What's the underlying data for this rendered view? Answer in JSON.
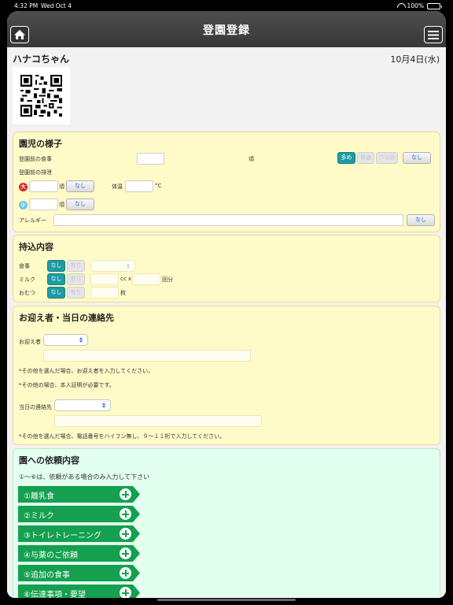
{
  "status_bar": {
    "time": "4:32 PM",
    "date": "Wed Oct 4",
    "battery": "100%"
  },
  "navbar": {
    "title": "登園登録"
  },
  "header": {
    "child_name": "ハナコちゃん",
    "date": "10月4日(水)"
  },
  "icons": {
    "home": "home-icon",
    "menu": "hamburger-menu-icon",
    "qr": "qr-code-icon",
    "expand": "plus-circle-icon"
  },
  "colors": {
    "teal_selected": "#1e9ba4",
    "section_yellow": "#fffbc8",
    "section_green": "#e3fff0",
    "item_green": "#14a04e",
    "poop_red": "#d9222a",
    "pee_blue": "#6ec3ef"
  },
  "condition": {
    "title": "園児の様子",
    "meal_label": "登園前の食事",
    "time_suffix": "頃",
    "amount_options": [
      "多め",
      "普通",
      "少な目"
    ],
    "selected_amount": "多め",
    "none_label": "なし",
    "excretion_label": "登園前の排泄",
    "poop_badge": "大",
    "pee_badge": "小",
    "temp_label": "体温",
    "temp_unit": "°C",
    "allergy_label": "アレルギー"
  },
  "belongings": {
    "title": "持込内容",
    "food_label": "食事",
    "milk_label": "ミルク",
    "diaper_label": "おむつ",
    "none_label": "なし",
    "present_label": "有り",
    "cc_label": "cc x",
    "times_label": "回分",
    "sheets_label": "枚"
  },
  "pickup": {
    "title": "お迎え者・当日の連絡先",
    "pickup_label": "お迎え者",
    "note1": "*その他を選んだ場合、お迎え者を入力してください。",
    "note2": "*その他の場合、本人証明が必要です。",
    "contact_label": "当日の連絡先",
    "note3": "*その他を選んだ場合、電話番号をハイフン無し、９～１１桁で入力してください。"
  },
  "requests": {
    "title": "園への依頼内容",
    "instruction": "①～⑥は、依頼がある場合のみ入力して下さい",
    "items": [
      "①離乳食",
      "②ミルク",
      "③トイレトレーニング",
      "④与薬のご依頼",
      "⑤追加の食事",
      "⑥伝達事項・要望"
    ]
  }
}
